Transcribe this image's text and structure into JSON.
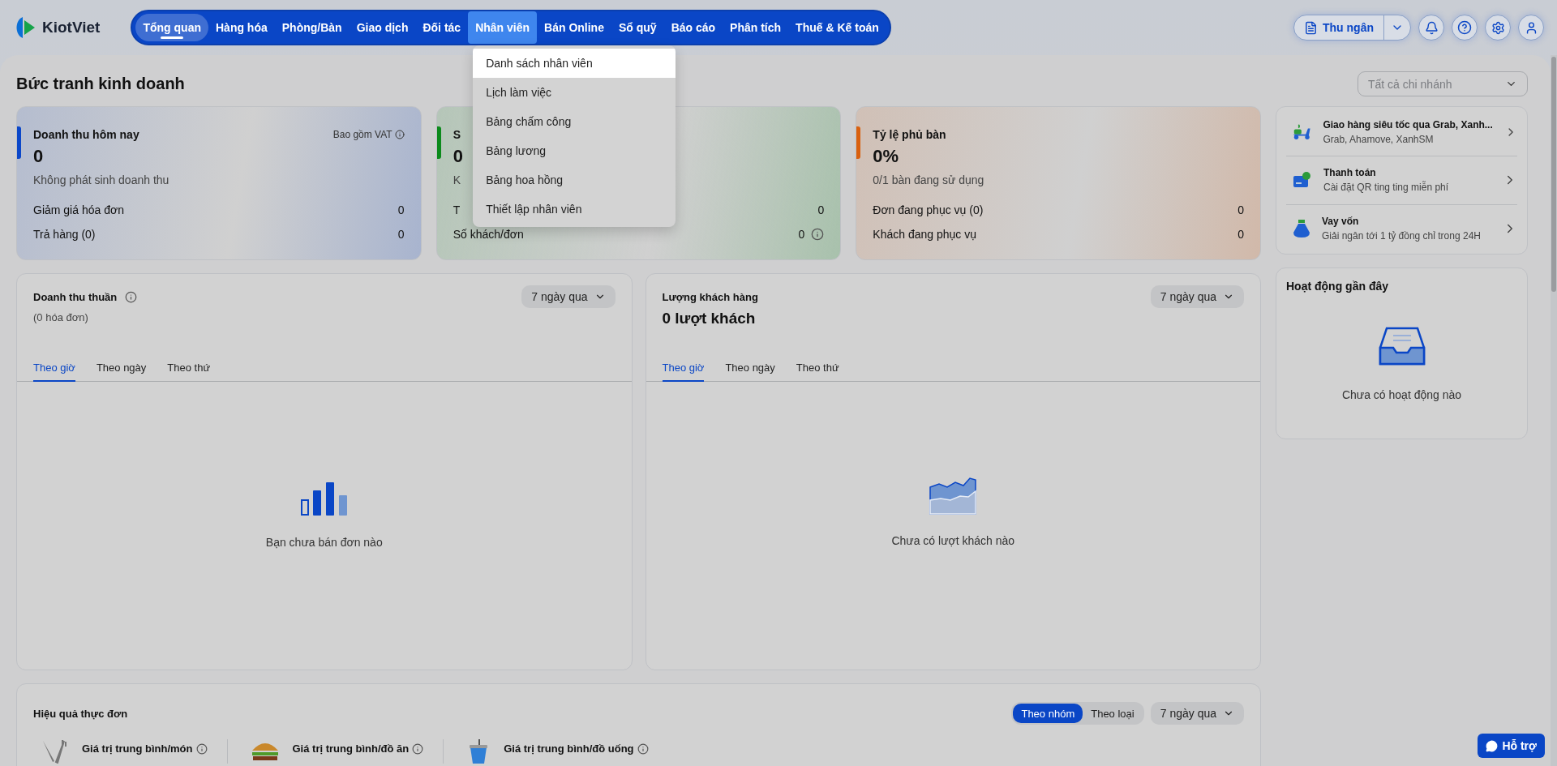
{
  "header": {
    "logo": "KiotViet",
    "nav": [
      {
        "label": "Tổng quan",
        "selected": true,
        "open": false
      },
      {
        "label": "Hàng hóa",
        "selected": false,
        "open": false
      },
      {
        "label": "Phòng/Bàn",
        "selected": false,
        "open": false
      },
      {
        "label": "Giao dịch",
        "selected": false,
        "open": false
      },
      {
        "label": "Đối tác",
        "selected": false,
        "open": false
      },
      {
        "label": "Nhân viên",
        "selected": false,
        "open": true
      },
      {
        "label": "Bán Online",
        "selected": false,
        "open": false
      },
      {
        "label": "Sổ quỹ",
        "selected": false,
        "open": false
      },
      {
        "label": "Báo cáo",
        "selected": false,
        "open": false
      },
      {
        "label": "Phân tích",
        "selected": false,
        "open": false
      },
      {
        "label": "Thuế & Kế toán",
        "selected": false,
        "open": false
      }
    ],
    "cashier_button": "Thu ngân"
  },
  "nav_menu": {
    "items": [
      {
        "label": "Danh sách nhân viên",
        "selected": true
      },
      {
        "label": "Lịch làm việc",
        "selected": false
      },
      {
        "label": "Bảng chấm công",
        "selected": false
      },
      {
        "label": "Bảng lương",
        "selected": false
      },
      {
        "label": "Bảng hoa hồng",
        "selected": false
      },
      {
        "label": "Thiết lập nhân viên",
        "selected": false
      }
    ]
  },
  "page": {
    "title": "Bức tranh kinh doanh",
    "branch_select": "Tất cả chi nhánh"
  },
  "summary_cards": [
    {
      "color": "#0b47c9",
      "title": "Doanh thu hôm nay",
      "note": "Bao gồm VAT",
      "value": "0",
      "subtitle": "Không phát sinh doanh thu",
      "rows": [
        {
          "label": "Giảm giá hóa đơn",
          "value": "0",
          "info": false
        },
        {
          "label": "Trả hàng (0)",
          "value": "0",
          "info": false
        }
      ]
    },
    {
      "color": "#0c8a1c",
      "title": "S",
      "value": "0",
      "subtitle": "K",
      "rows": [
        {
          "label": "T",
          "value": "0",
          "info": false
        },
        {
          "label": "Số khách/đơn",
          "value": "0",
          "info": true
        }
      ]
    },
    {
      "color": "#d9600f",
      "title": "Tỷ lệ phủ bàn",
      "value": "0%",
      "subtitle": "0/1 bàn đang sử dụng",
      "rows": [
        {
          "label": "Đơn đang phục vụ (0)",
          "value": "0",
          "info": false
        },
        {
          "label": "Khách đang phục vụ",
          "value": "0",
          "info": false
        }
      ]
    }
  ],
  "promos": [
    {
      "kind": "delivery",
      "title": "Giao hàng siêu tốc qua Grab, Xanh...",
      "subtitle": "Grab, Ahamove, XanhSM"
    },
    {
      "kind": "payment",
      "title": "Thanh toán",
      "subtitle": "Cài đặt QR ting ting miễn phí"
    },
    {
      "kind": "loan",
      "title": "Vay vốn",
      "subtitle": "Giải ngân tới 1 tỷ đồng chỉ trong 24H"
    }
  ],
  "recent_activity": {
    "title": "Hoạt động gần đây",
    "empty_text": "Chưa có hoạt động nào"
  },
  "charts": [
    {
      "kind": "bars",
      "title": "Doanh thu thuần",
      "info": true,
      "subtitle": "(0 hóa đơn)",
      "period": "7 ngày qua",
      "tabs": [
        {
          "label": "Theo giờ",
          "selected": true
        },
        {
          "label": "Theo ngày",
          "selected": false
        },
        {
          "label": "Theo thứ",
          "selected": false
        }
      ],
      "empty_text": "Bạn chưa bán đơn nào"
    },
    {
      "kind": "area",
      "title": "Lượng khách hàng",
      "info": false,
      "headline": "0 lượt khách",
      "period": "7 ngày qua",
      "tabs": [
        {
          "label": "Theo giờ",
          "selected": true
        },
        {
          "label": "Theo ngày",
          "selected": false
        },
        {
          "label": "Theo thứ",
          "selected": false
        }
      ],
      "empty_text": "Chưa có lượt khách nào"
    }
  ],
  "menu_performance": {
    "title": "Hiệu quả thực đơn",
    "segments": [
      {
        "label": "Theo nhóm",
        "selected": true
      },
      {
        "label": "Theo loại",
        "selected": false
      }
    ],
    "period": "7 ngày qua",
    "metrics": [
      {
        "kind": "dish",
        "label": "Giá trị trung bình/món"
      },
      {
        "kind": "food",
        "label": "Giá trị trung bình/đồ ăn"
      },
      {
        "kind": "drink",
        "label": "Giá trị trung bình/đồ uống"
      }
    ]
  },
  "help_button": "Hỗ trợ"
}
